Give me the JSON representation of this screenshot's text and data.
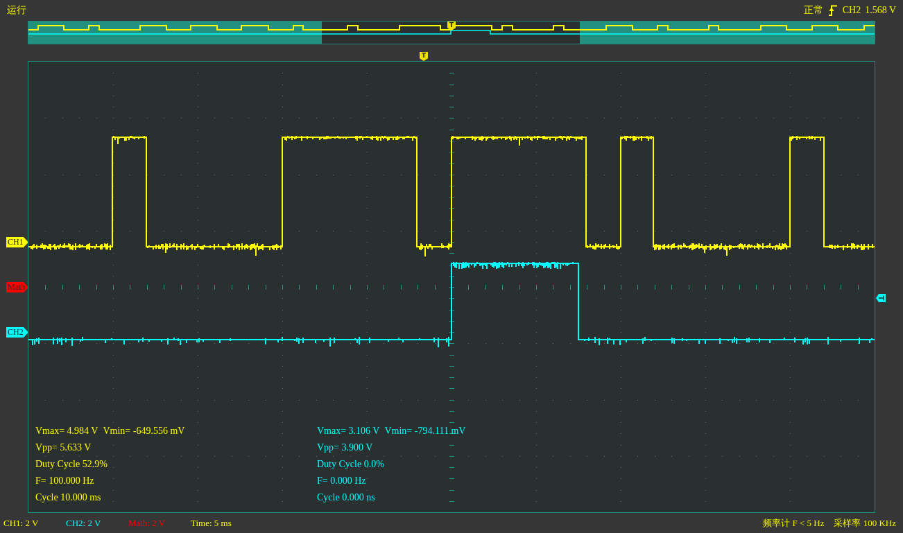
{
  "top_bar": {
    "run_state": "运行",
    "trigger_mode": "正常",
    "trigger_source": "CH2",
    "trigger_level": "1.568 V"
  },
  "overview": {
    "trigger_label": "T"
  },
  "scope": {
    "trigger_label": "T",
    "channel_markers": [
      {
        "label": "CH1",
        "color": "#ffff00"
      },
      {
        "label": "Math",
        "color": "#ff0000"
      },
      {
        "label": "CH2",
        "color": "#00ffff"
      }
    ],
    "measurements": [
      {
        "color": "#ffff00",
        "rows": [
          [
            "Vmax= 4.984 V",
            "Vmin= -649.556 mV"
          ],
          [
            "Vpp= 5.633 V"
          ],
          [
            "Duty Cycle 52.9%"
          ],
          [
            "F= 100.000 Hz"
          ],
          [
            "Cycle 10.000 ms"
          ]
        ]
      },
      {
        "color": "#00ffff",
        "rows": [
          [
            "Vmax= 3.106 V",
            "Vmin= -794.111 mV"
          ],
          [
            "Vpp= 3.900 V"
          ],
          [
            "Duty Cycle 0.0%"
          ],
          [
            "F= 0.000 Hz"
          ],
          [
            "Cycle 0.000 ns"
          ]
        ]
      }
    ]
  },
  "status_bar": {
    "scales": [
      {
        "text": "CH1: 2 V",
        "color": "#ffff00"
      },
      {
        "text": "CH2: 2 V",
        "color": "#00ffff"
      },
      {
        "text": "Math: 2 V",
        "color": "#ff0000"
      },
      {
        "text": "Time: 5 ms",
        "color": "#ffff00"
      }
    ],
    "frequency_counter": "频率计 F < 5 Hz",
    "sample_rate": "采样率 100 KHz"
  }
}
